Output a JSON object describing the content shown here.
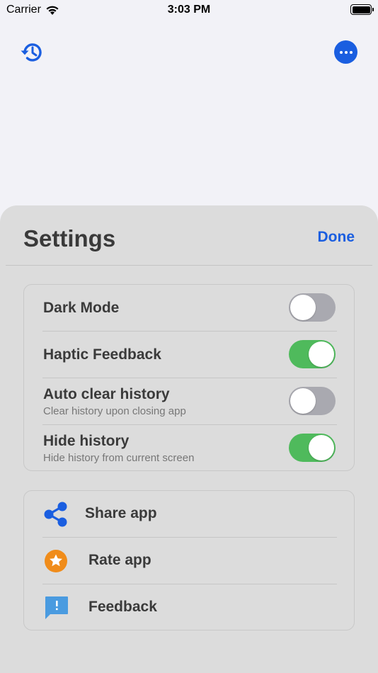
{
  "status_bar": {
    "carrier": "Carrier",
    "time": "3:03 PM"
  },
  "icons": {
    "history": "history-icon",
    "more": "more-icon",
    "share": "share-icon",
    "rate": "star-icon",
    "feedback": "feedback-icon",
    "wifi": "wifi-icon",
    "battery": "battery-icon"
  },
  "colors": {
    "accent": "#1a5ee0",
    "toggle_on": "#4fba5c",
    "toggle_off": "#a9a9b0",
    "star": "#f08c1a",
    "feedback": "#4a9be0"
  },
  "settings": {
    "title": "Settings",
    "done_label": "Done",
    "toggles": [
      {
        "label": "Dark Mode",
        "subtitle": "",
        "enabled": false
      },
      {
        "label": "Haptic Feedback",
        "subtitle": "",
        "enabled": true
      },
      {
        "label": "Auto clear history",
        "subtitle": "Clear history upon closing app",
        "enabled": false
      },
      {
        "label": "Hide history",
        "subtitle": "Hide history from current screen",
        "enabled": true
      }
    ],
    "actions": [
      {
        "label": "Share app"
      },
      {
        "label": "Rate app"
      },
      {
        "label": "Feedback"
      }
    ]
  }
}
